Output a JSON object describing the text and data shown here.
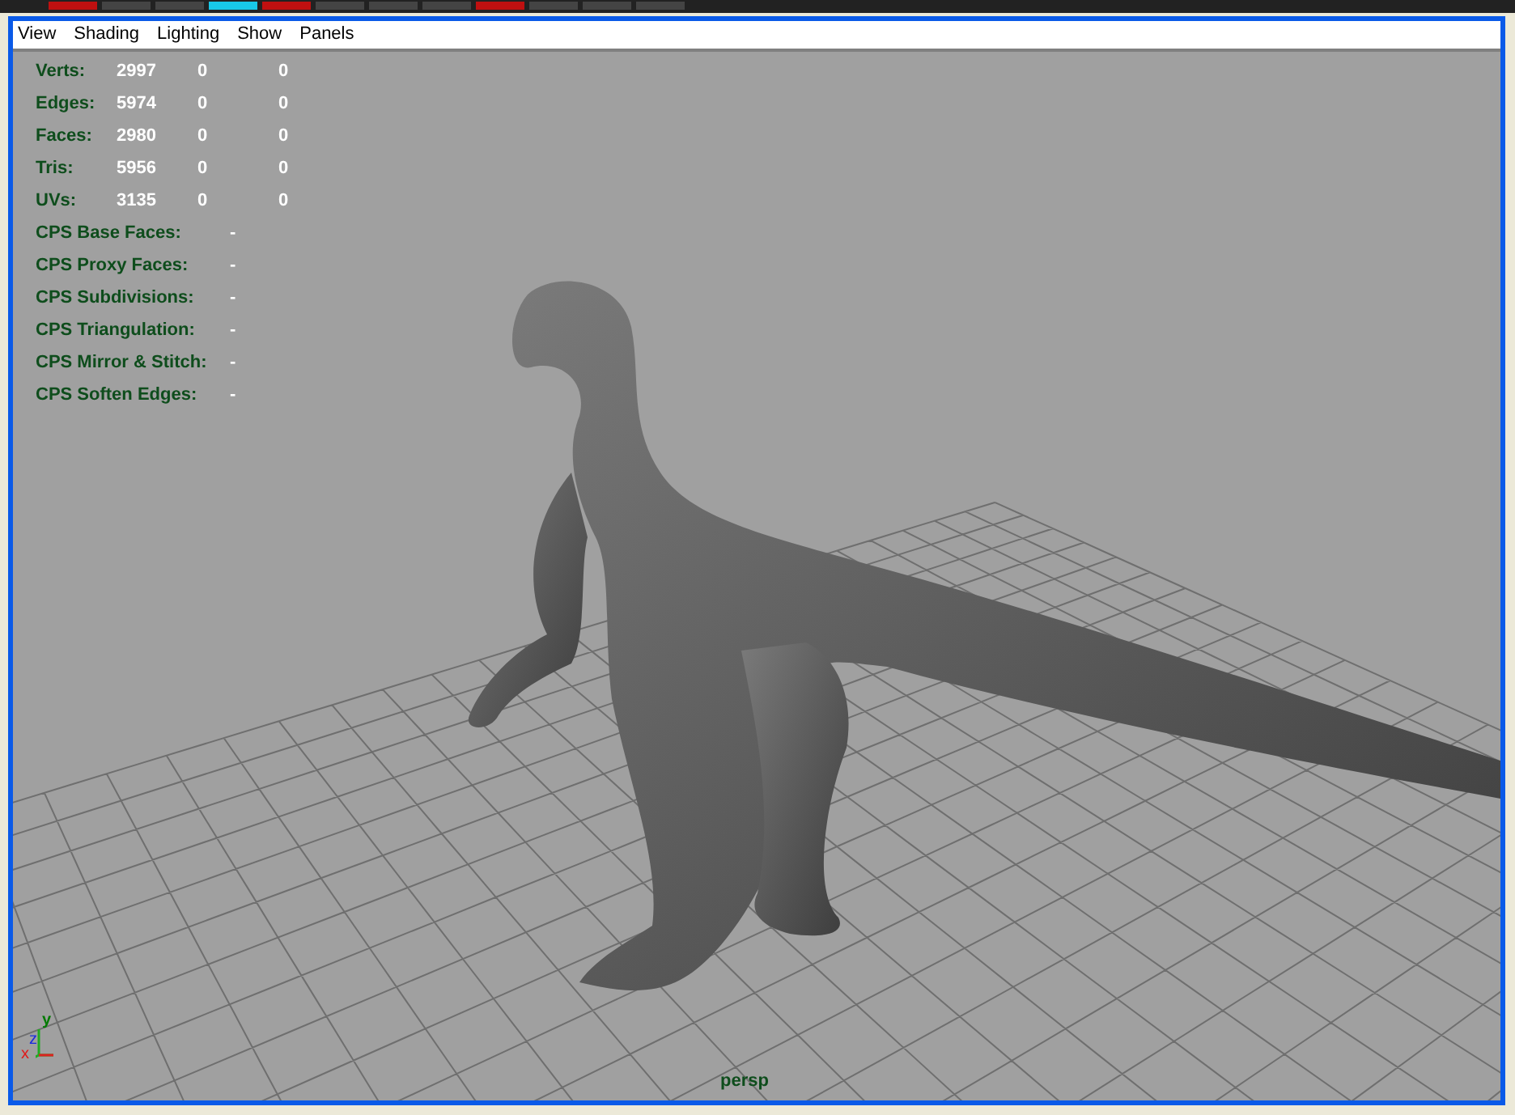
{
  "menu": [
    {
      "label": "View"
    },
    {
      "label": "Shading"
    },
    {
      "label": "Lighting"
    },
    {
      "label": "Show"
    },
    {
      "label": "Panels"
    }
  ],
  "stats": [
    {
      "label": "Verts:",
      "values": [
        "2997",
        "0",
        "0"
      ]
    },
    {
      "label": "Edges:",
      "values": [
        "5974",
        "0",
        "0"
      ]
    },
    {
      "label": "Faces:",
      "values": [
        "2980",
        "0",
        "0"
      ]
    },
    {
      "label": "Tris:",
      "values": [
        "5956",
        "0",
        "0"
      ]
    },
    {
      "label": "UVs:",
      "values": [
        "3135",
        "0",
        "0"
      ]
    }
  ],
  "cps": [
    {
      "label": "CPS Base Faces:",
      "value": "-"
    },
    {
      "label": "CPS Proxy Faces:",
      "value": "-"
    },
    {
      "label": "CPS Subdivisions:",
      "value": "-"
    },
    {
      "label": "CPS Triangulation:",
      "value": "-"
    },
    {
      "label": "CPS Mirror & Stitch:",
      "value": "-"
    },
    {
      "label": "CPS Soften Edges:",
      "value": "-"
    }
  ],
  "axes": {
    "y": "y",
    "z": "z",
    "x": "x"
  },
  "camera": "persp"
}
